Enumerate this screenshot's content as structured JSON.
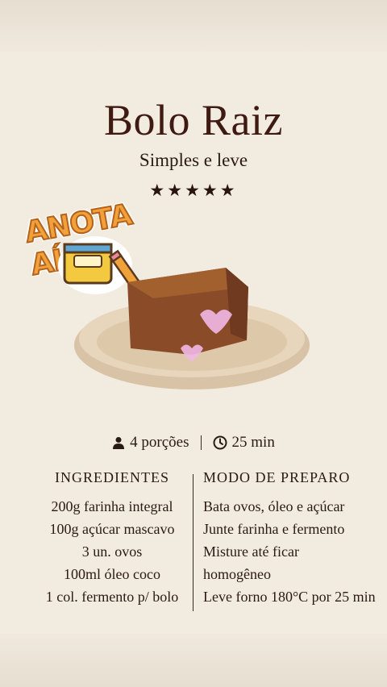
{
  "recipe": {
    "title": "Bolo Raiz",
    "subtitle": "Simples e leve",
    "rating": "★★★★★",
    "sticker": "ANOTA AÍ",
    "servings": "4 porções",
    "time": "25 min",
    "ingredients_header": "INGREDIENTES",
    "ingredients": [
      "200g farinha integral",
      "100g açúcar mascavo",
      "3 un. ovos",
      "100ml óleo coco",
      "1 col. fermento p/ bolo"
    ],
    "steps_header": "MODO DE PREPARO",
    "steps": [
      "Bata ovos, óleo e açúcar",
      "Junte farinha e fermento",
      "Misture até ficar",
      "homogêneo",
      "Leve forno 180°C por 25 min"
    ]
  },
  "icons": {
    "servings": "person-icon",
    "time": "clock-icon",
    "sticker": "notebook-pencil-icon"
  },
  "colors": {
    "title": "#3e1a12",
    "background": "#f2ebe0",
    "sticker_fill": "#f0a13a"
  }
}
